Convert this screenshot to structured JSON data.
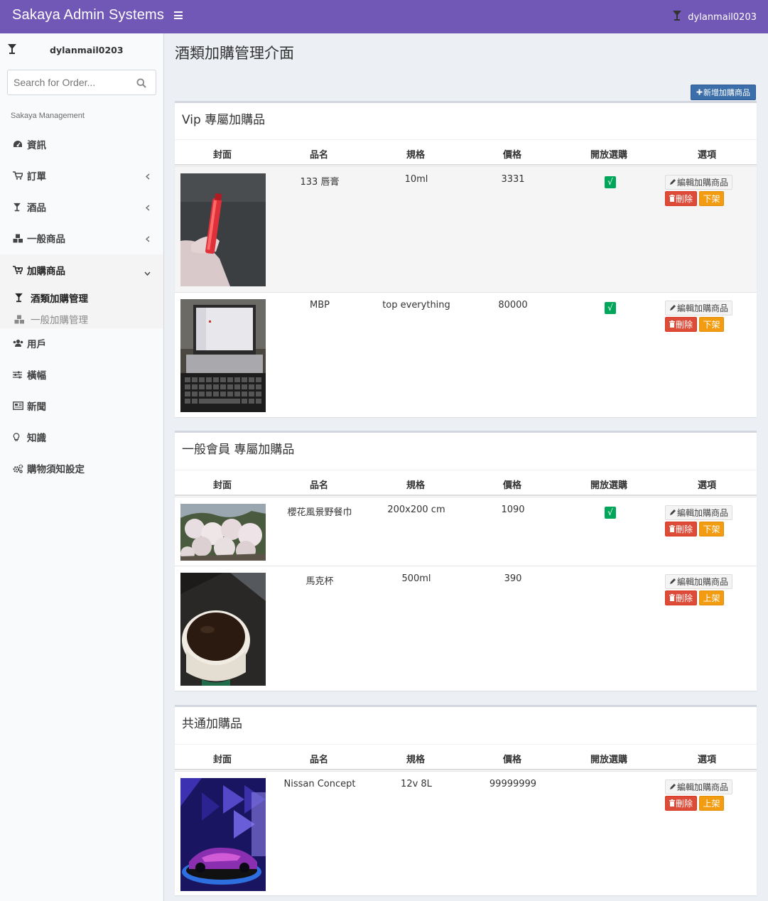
{
  "app": {
    "brand": "Sakaya Admin Systems",
    "username": "dylanmail0203"
  },
  "sidebar": {
    "username": "dylanmail0203",
    "search_placeholder": "Search for Order...",
    "section_header": "Sakaya Management",
    "items": [
      {
        "label": "資訊",
        "icon": "dashboard-icon"
      },
      {
        "label": "訂單",
        "icon": "cart-icon"
      },
      {
        "label": "酒品",
        "icon": "cocktail-glass-icon"
      },
      {
        "label": "一般商品",
        "icon": "cubes-icon"
      },
      {
        "label": "加購商品",
        "icon": "cart-plus-icon"
      },
      {
        "label": "用戶",
        "icon": "users-icon"
      },
      {
        "label": "橫幅",
        "icon": "sliders-icon"
      },
      {
        "label": "新聞",
        "icon": "newspaper-icon"
      },
      {
        "label": "知識",
        "icon": "lightbulb-icon"
      },
      {
        "label": "購物須知設定",
        "icon": "cogs-icon"
      }
    ],
    "submenu": [
      {
        "label": "酒類加購管理",
        "icon": "cocktail-glass-icon",
        "active": true
      },
      {
        "label": "一般加購管理",
        "icon": "cubes-icon",
        "active": false
      }
    ]
  },
  "page": {
    "title": "酒類加購管理介面",
    "add_button": "新增加購商品"
  },
  "table_headers": [
    "封面",
    "品名",
    "規格",
    "價格",
    "開放選購",
    "選項"
  ],
  "actions": {
    "edit": "編輯加購商品",
    "delete": "刪除",
    "unlist": "下架",
    "list": "上架",
    "check": "√"
  },
  "sections": [
    {
      "title": "Vip 專屬加購品",
      "rows": [
        {
          "name": "133 唇膏",
          "spec": "10ml",
          "price": "3331",
          "open": true,
          "shelf": "下架",
          "image": "lipstick"
        },
        {
          "name": "MBP",
          "spec": "top everything",
          "price": "80000",
          "open": true,
          "shelf": "下架",
          "image": "laptop"
        }
      ]
    },
    {
      "title": "一般會員 專屬加購品",
      "rows": [
        {
          "name": "櫻花風景野餐巾",
          "spec": "200x200 cm",
          "price": "1090",
          "open": true,
          "shelf": "下架",
          "image": "cherry-blossom"
        },
        {
          "name": "馬克杯",
          "spec": "500ml",
          "price": "390",
          "open": false,
          "shelf": "上架",
          "image": "coffee-mug"
        }
      ]
    },
    {
      "title": "共通加購品",
      "rows": [
        {
          "name": "Nissan Concept",
          "spec": "12v 8L",
          "price": "99999999",
          "open": false,
          "shelf": "上架",
          "image": "concept-car"
        }
      ]
    }
  ],
  "colors": {
    "navbar": "#7158b6",
    "primary_button": "#3c6eaa",
    "success": "#00a65a",
    "danger": "#dd4b39",
    "warning": "#f39c12"
  }
}
